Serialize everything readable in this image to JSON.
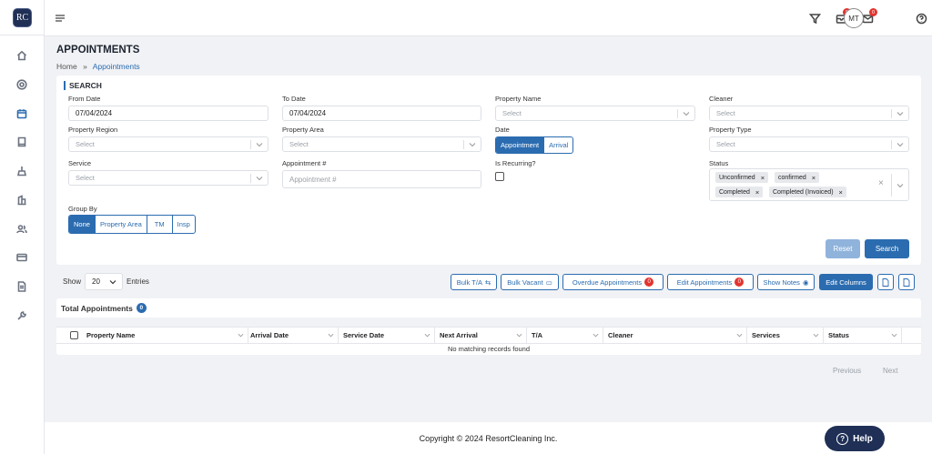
{
  "app": {
    "logo": "RC",
    "user_initials": "MT",
    "filter_badge": "0",
    "inbox_badge": "0"
  },
  "page": {
    "title": "APPOINTMENTS",
    "breadcrumb_home": "Home",
    "breadcrumb_sep": "»",
    "breadcrumb_current": "Appointments"
  },
  "search": {
    "title": "SEARCH",
    "from_date_label": "From Date",
    "from_date": "07/04/2024",
    "to_date_label": "To Date",
    "to_date": "07/04/2024",
    "property_name_label": "Property Name",
    "property_name_ph": "Select",
    "cleaner_label": "Cleaner",
    "cleaner_ph": "Select",
    "property_region_label": "Property Region",
    "property_region_ph": "Select",
    "property_area_label": "Property Area",
    "property_area_ph": "Select",
    "date_label": "Date",
    "date_opt_appointment": "Appointment",
    "date_opt_arrival": "Arrival",
    "property_type_label": "Property Type",
    "property_type_ph": "Select",
    "service_label": "Service",
    "service_ph": "Select",
    "appointment_no_label": "Appointment #",
    "appointment_no_ph": "Appointment #",
    "recurring_label": "Is Recurring?",
    "status_label": "Status",
    "status_tags": [
      "Unconfirmed",
      "confirmed",
      "Completed",
      "Completed (Invoiced)"
    ],
    "group_by_label": "Group By",
    "group_opts": [
      "None",
      "Property Area",
      "TM",
      "Insp"
    ],
    "reset": "Reset",
    "search": "Search"
  },
  "toolbar": {
    "show": "Show",
    "entries_value": "20",
    "entries": "Entries",
    "bulk_ta": "Bulk T/A",
    "bulk_vacant": "Bulk Vacant",
    "overdue": "Overdue Appointments",
    "overdue_count": "0",
    "edit_appts": "Edit Appointments",
    "edit_count": "0",
    "show_notes": "Show Notes",
    "edit_columns": "Edit Columns"
  },
  "table": {
    "total_label": "Total Appointments",
    "total_count": "0",
    "columns": [
      "Property Name",
      "Arrival Date",
      "Service Date",
      "Next Arrival",
      "T/A",
      "Cleaner",
      "Services",
      "Status"
    ],
    "empty": "No matching records found",
    "prev": "Previous",
    "next": "Next"
  },
  "footer": {
    "copyright": "Copyright © 2024 ResortCleaning Inc.",
    "help": "Help"
  },
  "colors": {
    "accent": "#2b6cb0",
    "badge": "#e3342f",
    "help_bg": "#1f2f55"
  }
}
